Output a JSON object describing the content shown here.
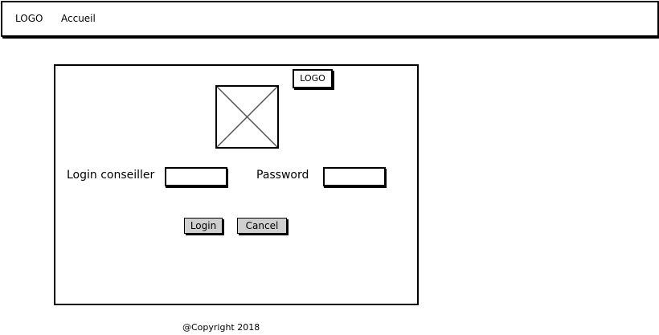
{
  "header": {
    "logo_text": "LOGO",
    "nav": [
      {
        "label": "Accueil"
      }
    ]
  },
  "login_panel": {
    "logo_badge": "LOGO",
    "image_icon": "image-placeholder-icon",
    "login_label": "Login conseiller",
    "login_value": "",
    "password_label": "Password",
    "password_value": "",
    "login_button": "Login",
    "cancel_button": "Cancel"
  },
  "footer": {
    "copyright": "@Copyright 2018"
  }
}
